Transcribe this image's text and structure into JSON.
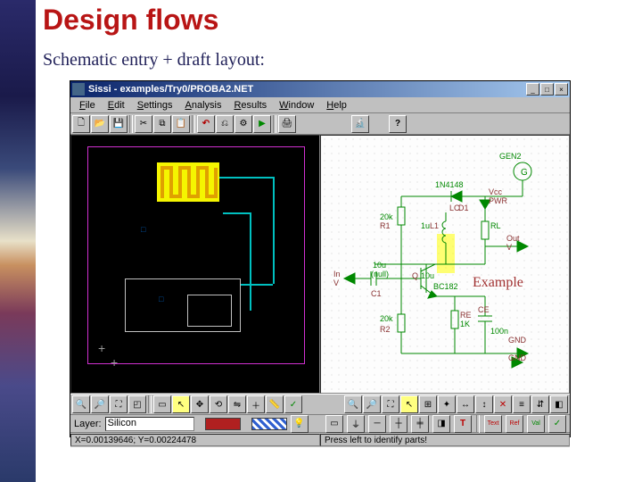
{
  "slide": {
    "heading": "Design flows",
    "subheading": "Schematic entry + draft layout:"
  },
  "titlebar": {
    "text": "Sissi - examples/Try0/PROBA2.NET"
  },
  "menu": {
    "file": "File",
    "edit": "Edit",
    "settings": "Settings",
    "analysis": "Analysis",
    "results": "Results",
    "window": "Window",
    "help": "Help"
  },
  "layer": {
    "label": "Layer:",
    "value": "Silicon"
  },
  "status": {
    "coords": "X=0.00139646; Y=0.00224478",
    "hint": "Press left to identify parts!"
  },
  "schematic": {
    "gen2": "GEN2",
    "diode": "1N4148",
    "vcc": "Vcc",
    "pwr": "PWR",
    "d1": "D1",
    "lc": "LC",
    "r1_v": "20k",
    "r1": "R1",
    "l1_v": "1u",
    "l1": "L1",
    "rl": "RL",
    "out": "Out",
    "v": "V",
    "c_in_v": "10u",
    "in_lbl": "(null)",
    "in": "In",
    "c1": "C1",
    "q": "Q",
    "q_v": "10u",
    "bc": "BC182",
    "example": "Example",
    "r2_v": "20k",
    "r2": "R2",
    "re_v": "RE",
    "re_1k": "1K",
    "ce": "CE",
    "ce_v": "100n",
    "gnd1": "GND",
    "gnd2": "GND"
  },
  "icons": {
    "new": "new",
    "open": "open",
    "save": "save",
    "cut": "cut",
    "copy": "copy",
    "paste": "paste",
    "undo": "undo",
    "print": "print",
    "micro": "microscope",
    "help": "?",
    "zin": "zoom-in",
    "zout": "zoom-out",
    "zfit": "zoom-fit"
  }
}
